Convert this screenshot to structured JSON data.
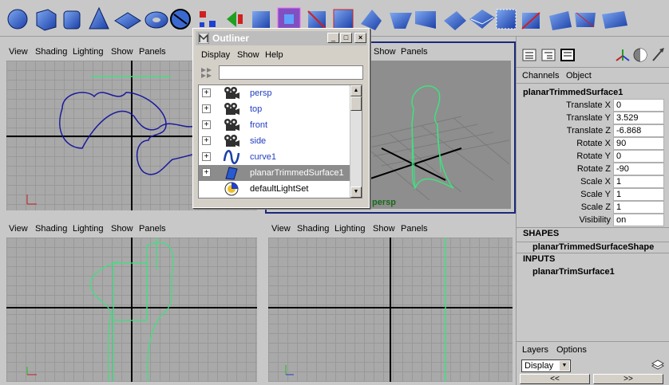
{
  "viewport_menu": [
    "View",
    "Shading",
    "Lighting",
    "Show",
    "Panels"
  ],
  "persp_label": "persp",
  "outliner": {
    "title": "Outliner",
    "menu": [
      "Display",
      "Show",
      "Help"
    ],
    "filter_value": "",
    "items": [
      {
        "label": "persp",
        "icon": "camera-icon"
      },
      {
        "label": "top",
        "icon": "camera-icon"
      },
      {
        "label": "front",
        "icon": "camera-icon"
      },
      {
        "label": "side",
        "icon": "camera-icon"
      },
      {
        "label": "curve1",
        "icon": "curve-icon"
      },
      {
        "label": "planarTrimmedSurface1",
        "icon": "surface-icon",
        "selected": true
      },
      {
        "label": "defaultLightSet",
        "icon": "light-set-icon"
      }
    ]
  },
  "channel_box": {
    "tabs": [
      "Channels",
      "Object"
    ],
    "node_name": "planarTrimmedSurface1",
    "channels": [
      {
        "name": "Translate X",
        "value": "0"
      },
      {
        "name": "Translate Y",
        "value": "3.529"
      },
      {
        "name": "Translate Z",
        "value": "-6.868"
      },
      {
        "name": "Rotate X",
        "value": "90"
      },
      {
        "name": "Rotate Y",
        "value": "0"
      },
      {
        "name": "Rotate Z",
        "value": "-90"
      },
      {
        "name": "Scale X",
        "value": "1"
      },
      {
        "name": "Scale Y",
        "value": "1"
      },
      {
        "name": "Scale Z",
        "value": "1"
      },
      {
        "name": "Visibility",
        "value": "on"
      }
    ],
    "shapes_header": "SHAPES",
    "shape_name": "planarTrimmedSurfaceShape",
    "inputs_header": "INPUTS",
    "input_name": "planarTrimSurface1"
  },
  "layers": {
    "tabs": [
      "Layers",
      "Options"
    ],
    "display_option": "Display",
    "prev_label": "<<",
    "next_label": ">>"
  },
  "colors": {
    "curve": "#1a1a9c",
    "surface": "#40e080",
    "persp_label": "#1a6a1a",
    "selection": "#8c8c8c"
  }
}
